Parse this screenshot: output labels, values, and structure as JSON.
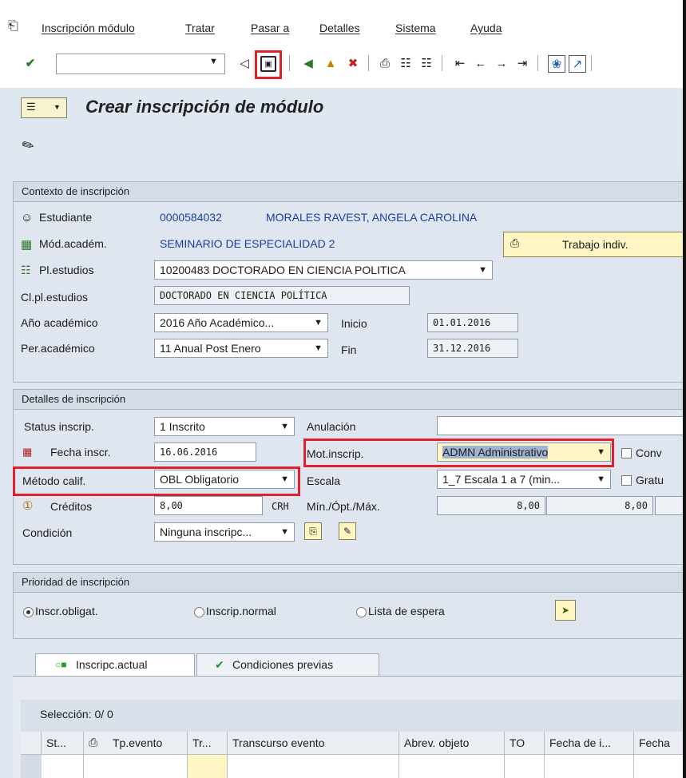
{
  "menu": {
    "items": [
      "Inscripción módulo",
      "Tratar",
      "Pasar a",
      "Detalles",
      "Sistema",
      "Ayuda"
    ]
  },
  "toolbar": {
    "command_value": ""
  },
  "title": "Crear inscripción de módulo",
  "contexto": {
    "header": "Contexto de inscripción",
    "estudiante_label": "Estudiante",
    "estudiante_id": "0000584032",
    "estudiante_name": "MORALES RAVEST, ANGELA CAROLINA",
    "modulo_label": "Mód.académ.",
    "modulo_value": "SEMINARIO DE ESPECIALIDAD 2",
    "trabajo_button": "Trabajo indiv.",
    "plan_label": "Pl.estudios",
    "plan_value": "10200483 DOCTORADO EN CIENCIA POLITICA",
    "clase_label": "Cl.pl.estudios",
    "clase_value": "DOCTORADO EN CIENCIA POLÍTICA",
    "anio_label": "Año académico",
    "anio_value": "2016 Año Académico...",
    "inicio_label": "Inicio",
    "inicio_value": "01.01.2016",
    "periodo_label": "Per.académico",
    "periodo_value": "11 Anual Post Enero",
    "fin_label": "Fin",
    "fin_value": "31.12.2016"
  },
  "detalles": {
    "header": "Detalles de inscripción",
    "status_label": "Status inscrip.",
    "status_value": "1 Inscrito",
    "anulacion_label": "Anulación",
    "anulacion_value": "",
    "fecha_label": "Fecha inscr.",
    "fecha_value": "16.06.2016",
    "mot_label": "Mot.inscrip.",
    "mot_value": "ADMN Administrativo",
    "conv_label": "Conv",
    "metodo_label": "Método calif.",
    "metodo_value": "OBL Obligatorio",
    "escala_label": "Escala",
    "escala_value": "1_7 Escala 1 a 7 (min...",
    "gratu_label": "Gratu",
    "creditos_label": "Créditos",
    "creditos_value": "8,00",
    "creditos_unit": "CRH",
    "minmax_label": "Mín./Ópt./Máx.",
    "min_value": "8,00",
    "opt_value": "8,00",
    "condicion_label": "Condición",
    "condicion_value": "Ninguna inscripc..."
  },
  "prioridad": {
    "header": "Prioridad de inscripción",
    "opt1": "Inscr.obligat.",
    "opt2": "Inscrip.normal",
    "opt3": "Lista de espera",
    "selected": "Inscr.obligat."
  },
  "tabs": [
    "Inscripc.actual",
    "Condiciones previas"
  ],
  "table": {
    "selection": "Selección: 0/ 0",
    "columns": [
      "St...",
      "Tp.evento",
      "Tr...",
      "Transcurso evento",
      "Abrev. objeto",
      "TO",
      "Fecha de i...",
      "Fecha"
    ]
  },
  "colors": {
    "highlight": "#e0202a",
    "link": "#1a3ea0",
    "background": "#dfe6ef"
  }
}
